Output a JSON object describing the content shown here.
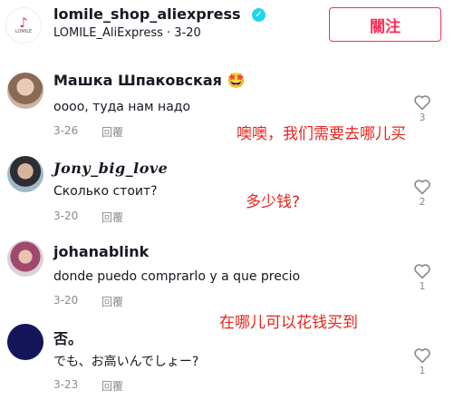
{
  "header": {
    "logo_text": "LOMILE",
    "shop_name": "lomile_shop_aliexpress",
    "subtitle": "LOMILE_AliExpress · 3-20",
    "follow_label": "關注"
  },
  "comments": [
    {
      "username": "Машка Шпаковская",
      "emoji": "🤩",
      "text": "оооо, туда нам надо",
      "date": "3-26",
      "reply": "回覆",
      "likes": "3"
    },
    {
      "username": "Jony_big_love",
      "text": "Сколько стоит?",
      "date": "3-20",
      "reply": "回覆",
      "likes": "2"
    },
    {
      "username": "johanablink",
      "text": "donde puedo comprarlo y a que precio",
      "date": "3-20",
      "reply": "回覆",
      "likes": "1"
    },
    {
      "username": "否。",
      "text": "でも、お高いんでしょー?",
      "date": "3-23",
      "reply": "回覆",
      "likes": "1"
    }
  ],
  "annotations": [
    "噢噢，我们需要去哪儿买",
    "多少钱?",
    "在哪儿可以花钱买到"
  ],
  "colors": {
    "accent": "#fe2c55",
    "verified": "#20d5ec",
    "annotation": "#e8231c",
    "muted": "#8a8b91"
  },
  "icons": [
    "verified-badge-icon",
    "heart-outline-icon"
  ]
}
